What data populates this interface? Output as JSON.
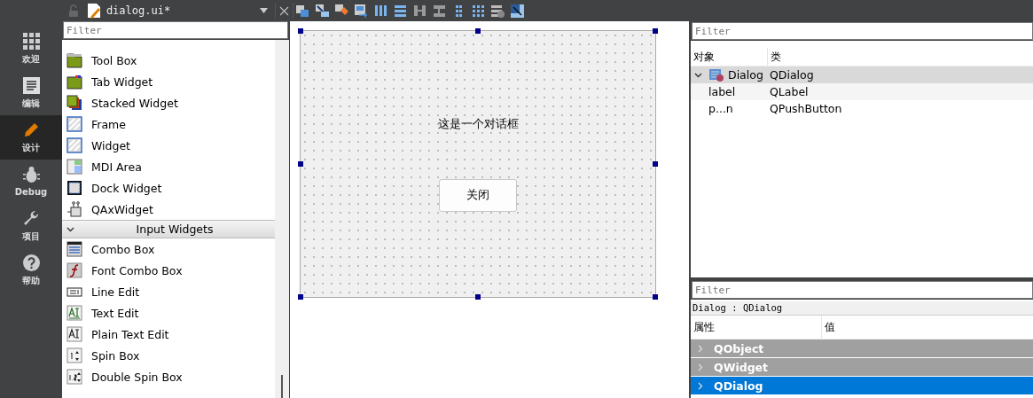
{
  "editor": {
    "file_name": "dialog.ui*"
  },
  "mode_bar": [
    {
      "label": "欢迎",
      "selected": false
    },
    {
      "label": "编辑",
      "selected": false
    },
    {
      "label": "设计",
      "selected": true
    },
    {
      "label": "Debug",
      "selected": false
    },
    {
      "label": "项目",
      "selected": false
    },
    {
      "label": "帮助",
      "selected": false
    }
  ],
  "widget_box": {
    "filter": {
      "placeholder": "Filter"
    },
    "items": [
      {
        "kind": "widget",
        "label": "Tool Box"
      },
      {
        "kind": "widget",
        "label": "Tab Widget"
      },
      {
        "kind": "widget",
        "label": "Stacked Widget"
      },
      {
        "kind": "widget",
        "label": "Frame"
      },
      {
        "kind": "widget",
        "label": "Widget"
      },
      {
        "kind": "widget",
        "label": "MDI Area"
      },
      {
        "kind": "widget",
        "label": "Dock Widget"
      },
      {
        "kind": "widget",
        "label": "QAxWidget"
      },
      {
        "kind": "category",
        "label": "Input Widgets",
        "expanded": true
      },
      {
        "kind": "widget",
        "label": "Combo Box"
      },
      {
        "kind": "widget",
        "label": "Font Combo Box"
      },
      {
        "kind": "widget",
        "label": "Line Edit"
      },
      {
        "kind": "widget",
        "label": "Text Edit"
      },
      {
        "kind": "widget",
        "label": "Plain Text Edit"
      },
      {
        "kind": "widget",
        "label": "Spin Box"
      },
      {
        "kind": "widget",
        "label": "Double Spin Box"
      }
    ]
  },
  "form": {
    "label": "这是一个对话框",
    "button": "关闭",
    "selected": true
  },
  "object_inspector": {
    "filter": {
      "placeholder": "Filter"
    },
    "columns": [
      "对象",
      "类"
    ],
    "rows": [
      {
        "object": "Dialog",
        "class": "QDialog",
        "selected": true,
        "expanded": true,
        "children": [
          {
            "object": "label",
            "class": "QLabel",
            "selected": false
          },
          {
            "object": "p...n",
            "class": "QPushButton",
            "selected": false
          }
        ]
      }
    ]
  },
  "property_editor": {
    "filter": {
      "placeholder": "Filter"
    },
    "object_label": "Dialog : QDialog",
    "columns": [
      "属性",
      "值"
    ],
    "groups": [
      {
        "name": "QObject",
        "selected": false
      },
      {
        "name": "QWidget",
        "selected": false
      },
      {
        "name": "QDialog",
        "selected": true
      }
    ]
  }
}
